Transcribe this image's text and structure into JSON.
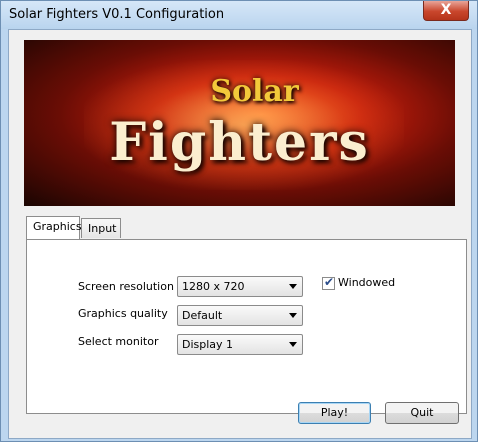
{
  "window": {
    "title": "Solar Fighters V0.1 Configuration",
    "close_label": "X"
  },
  "banner": {
    "logo_top": "Solar",
    "logo_bottom": "Fighters"
  },
  "tabs": [
    {
      "label": "Graphics",
      "active": true
    },
    {
      "label": "Input",
      "active": false
    }
  ],
  "graphics": {
    "screen_resolution_label": "Screen resolution",
    "screen_resolution_value": "1280 x 720",
    "graphics_quality_label": "Graphics quality",
    "graphics_quality_value": "Default",
    "select_monitor_label": "Select monitor",
    "select_monitor_value": "Display 1",
    "windowed_label": "Windowed",
    "windowed_checked": true
  },
  "buttons": {
    "play_label": "Play!",
    "quit_label": "Quit"
  }
}
